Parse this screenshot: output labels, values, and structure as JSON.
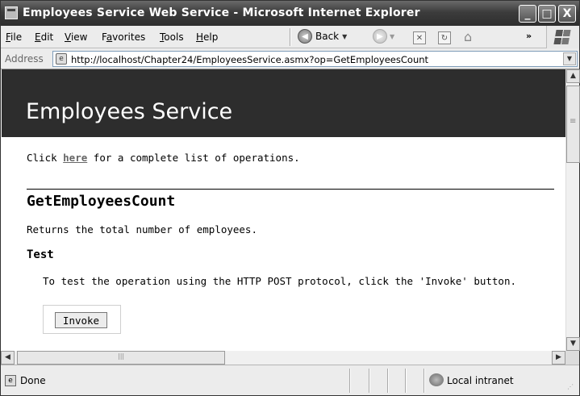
{
  "window": {
    "title": "Employees Service Web Service - Microsoft Internet Explorer",
    "minimize": "_",
    "maximize": "□",
    "close": "X"
  },
  "menu": {
    "items": [
      {
        "key": "F",
        "rest": "ile"
      },
      {
        "key": "E",
        "rest": "dit"
      },
      {
        "key": "V",
        "rest": "iew"
      },
      {
        "key": "a",
        "pre": "F",
        "rest": "vorites"
      },
      {
        "key": "T",
        "rest": "ools"
      },
      {
        "key": "H",
        "rest": "elp"
      }
    ]
  },
  "toolbar": {
    "back_label": "Back",
    "more_glyph": "»"
  },
  "address": {
    "label": "Address",
    "url": "http://localhost/Chapter24/EmployeesService.asmx?op=GetEmployeesCount"
  },
  "page": {
    "service_title": "Employees Service",
    "intro_prefix": "Click ",
    "intro_link": "here",
    "intro_suffix": " for a complete list of operations.",
    "operation_name": "GetEmployeesCount",
    "operation_description": "Returns the total number of employees.",
    "test_heading": "Test",
    "test_description": "To test the operation using the HTTP POST protocol, click the 'Invoke' button.",
    "invoke_label": "Invoke"
  },
  "status": {
    "text": "Done",
    "zone": "Local intranet"
  },
  "colors": {
    "banner": "#2d2d2d",
    "link": "#666666"
  }
}
